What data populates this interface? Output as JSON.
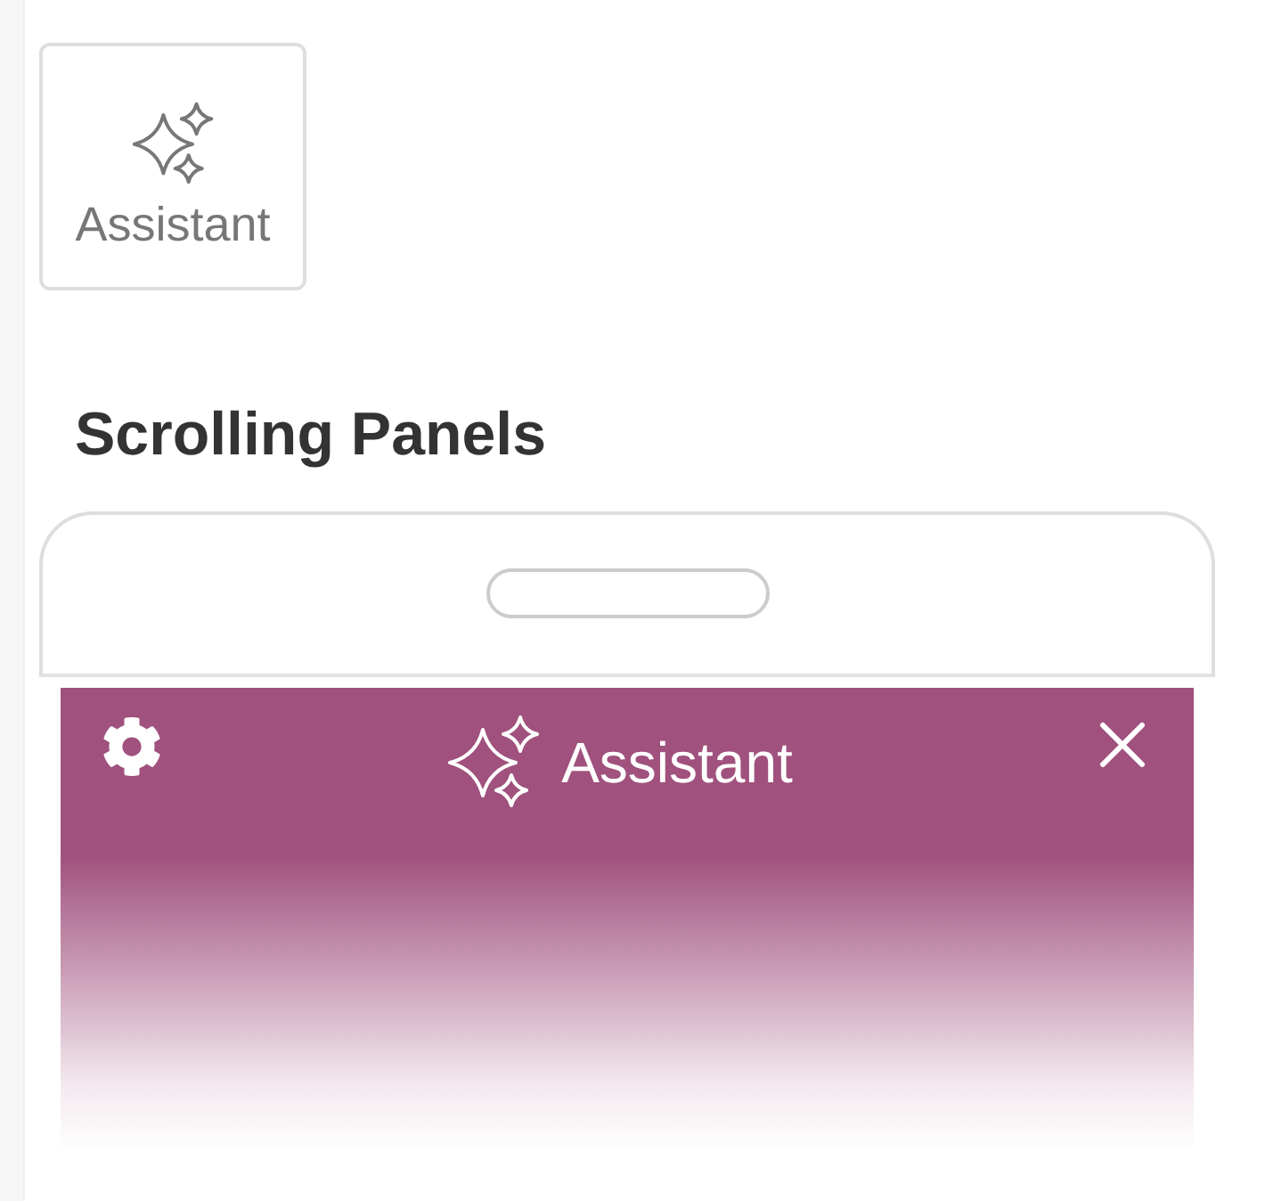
{
  "assistant_button": {
    "label": "Assistant"
  },
  "section_title": "Scrolling Panels",
  "phone_preview": {
    "panel": {
      "title": "Assistant"
    }
  }
}
